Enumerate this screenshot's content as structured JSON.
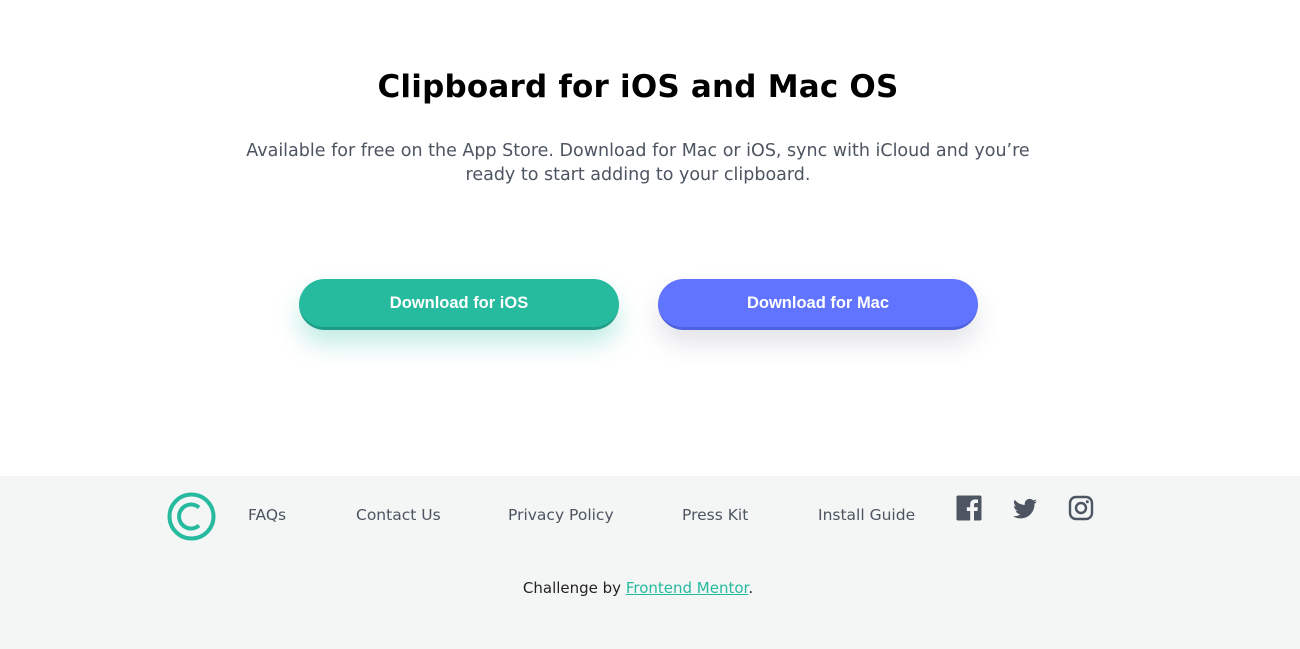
{
  "hero": {
    "title": "Clipboard for iOS and Mac OS",
    "description": "Available for free on the App Store. Download for Mac or iOS, sync with iCloud and you’re ready to start adding to your clipboard.",
    "buttons": {
      "ios_label": "Download for iOS",
      "mac_label": "Download for Mac"
    }
  },
  "footer": {
    "logo_icon": "copyright-circle-icon",
    "nav": [
      {
        "label": "FAQs"
      },
      {
        "label": "Contact Us"
      },
      {
        "label": "Privacy Policy"
      },
      {
        "label": "Press Kit"
      },
      {
        "label": "Install Guide"
      }
    ],
    "social": [
      "facebook-icon",
      "twitter-icon",
      "instagram-icon"
    ],
    "credit": {
      "prefix": "Challenge by ",
      "link": "Frontend Mentor",
      "suffix": "."
    }
  },
  "colors": {
    "accent_green": "#26ba9f",
    "accent_blue": "#6174ff",
    "footer_bg": "#f4f6f5",
    "text_gray": "#4c5561"
  }
}
